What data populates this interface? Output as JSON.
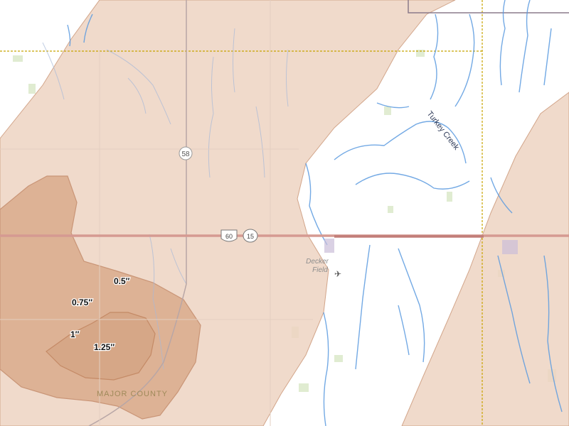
{
  "map": {
    "colors": {
      "background": "#ffffff",
      "swath_light": "#edd3c2",
      "swath_medium": "#d9aa8c",
      "swath_dark": "#c9916c",
      "swath_edge": "#d2a58a",
      "water": "#5b9be0",
      "road": "#b8a6a6",
      "highway": "#d59a92",
      "boundary": "#c7a300",
      "vegetation": "#cde0b4"
    },
    "hail_labels": [
      {
        "text": "0.5″"
      },
      {
        "text": "0.75″"
      },
      {
        "text": "1″"
      },
      {
        "text": "1.25″"
      }
    ],
    "route_shields": [
      {
        "text": "58"
      },
      {
        "text": "60"
      },
      {
        "text": "15"
      }
    ],
    "place_labels": {
      "airport": "Decker\nField",
      "creek": "Turkey Creek",
      "county": "MAJOR COUNTY"
    }
  }
}
